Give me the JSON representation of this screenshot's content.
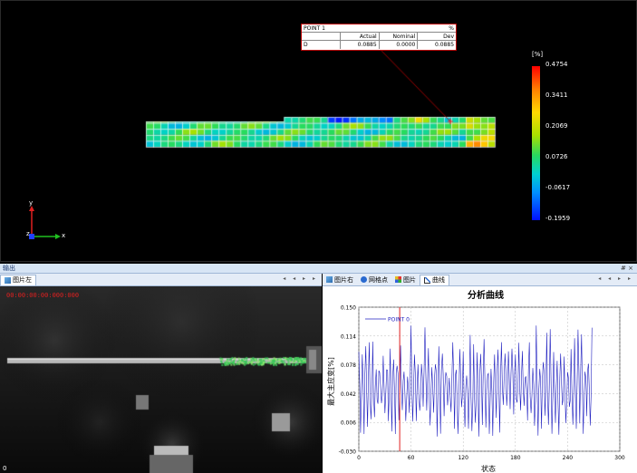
{
  "viewport": {
    "callout": {
      "title": "POINT 1",
      "unit": "%",
      "headers": [
        "Actual",
        "Nominal",
        "Dev"
      ],
      "row_label": "D",
      "values": [
        "0.0885",
        "0.0000",
        "0.0885"
      ]
    },
    "legend": {
      "unit": "[%]",
      "ticks": [
        "0.4754",
        "0.3411",
        "0.2069",
        "0.0726",
        "-0.0617",
        "-0.1959"
      ]
    },
    "axes": {
      "y": "y",
      "z": "z",
      "x": "x"
    }
  },
  "dock": {
    "title": "输出",
    "controls": "# ×"
  },
  "left_panel": {
    "tab_label": "图片左",
    "nav": "◂ ◂ ▸ ▸",
    "timecode": "00:00:00:00:000:000",
    "frame_index": "0"
  },
  "right_panel": {
    "tabs": [
      "图片右",
      "网格点",
      "图片",
      "曲线"
    ],
    "nav": "◂ ◂ ▸ ▸"
  },
  "chart_data": {
    "type": "line",
    "title": "分析曲线",
    "xlabel": "状态",
    "ylabel": "最大主应变[%]",
    "xlim": [
      0,
      300
    ],
    "ylim": [
      -0.03,
      0.15
    ],
    "xticks": [
      "0",
      "60",
      "120",
      "180",
      "240",
      "300"
    ],
    "yticks": [
      "0.150",
      "0.114",
      "0.078",
      "0.042",
      "0.006",
      "-0.030"
    ],
    "marker_x": 47,
    "series": [
      {
        "name": "POINT 0",
        "color": "#2020c0",
        "x_start": 0,
        "x_end": 268,
        "low_range": [
          -0.012,
          0.032
        ],
        "high_range": [
          0.06,
          0.13
        ]
      }
    ]
  }
}
